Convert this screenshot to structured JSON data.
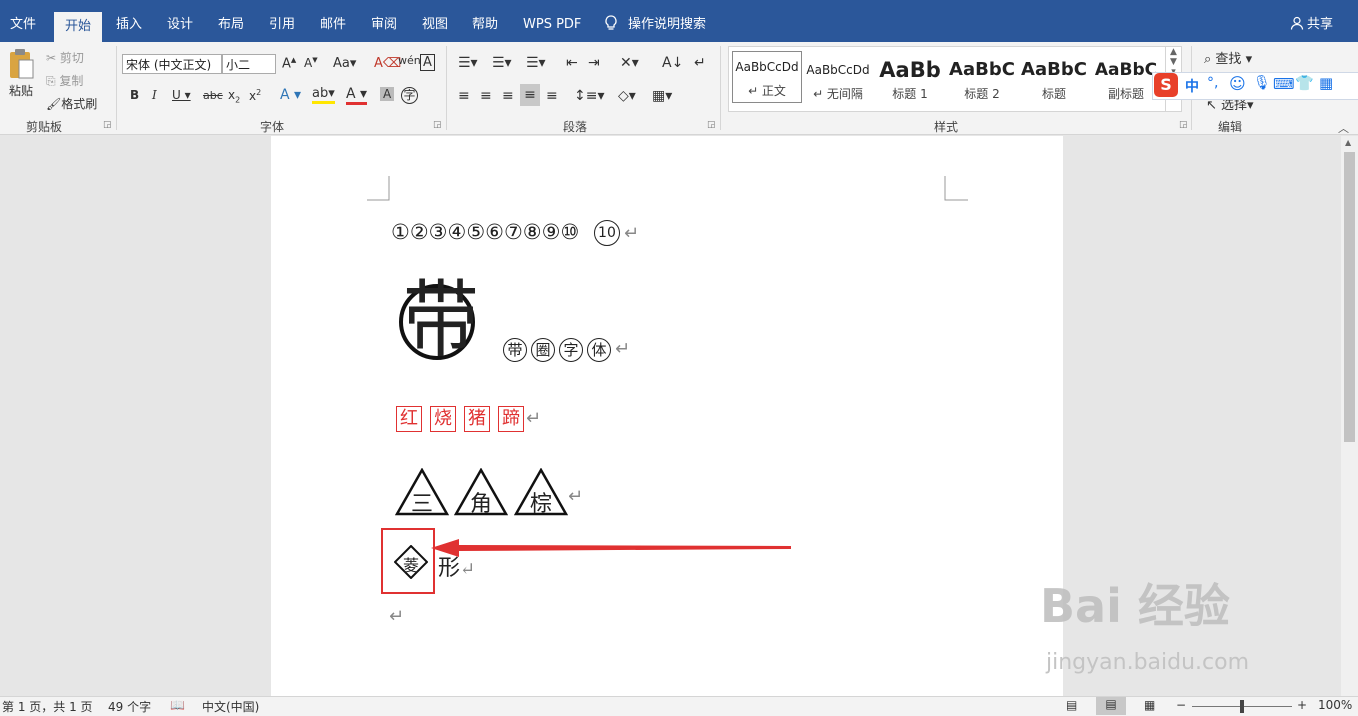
{
  "tabs": [
    {
      "label": "文件"
    },
    {
      "label": "开始"
    },
    {
      "label": "插入"
    },
    {
      "label": "设计"
    },
    {
      "label": "布局"
    },
    {
      "label": "引用"
    },
    {
      "label": "邮件"
    },
    {
      "label": "审阅"
    },
    {
      "label": "视图"
    },
    {
      "label": "帮助"
    },
    {
      "label": "WPS PDF"
    }
  ],
  "tell_me": "操作说明搜索",
  "share": "共享",
  "clipboard": {
    "paste": "粘贴",
    "cut": "剪切",
    "copy": "复制",
    "format_painter": "格式刷",
    "group": "剪贴板"
  },
  "font": {
    "family": "宋体 (中文正文)",
    "size": "小二",
    "group": "字体"
  },
  "paragraph": {
    "group": "段落"
  },
  "styles": {
    "group": "样式",
    "items": [
      {
        "preview": "AaBbCcDd",
        "name": "↵ 正文"
      },
      {
        "preview": "AaBbCcDd",
        "name": "↵ 无间隔"
      },
      {
        "preview": "AaBb",
        "name": "标题 1"
      },
      {
        "preview": "AaBbC",
        "name": "标题 2"
      },
      {
        "preview": "AaBbC",
        "name": "标题"
      },
      {
        "preview": "AaBbC",
        "name": "副标题"
      }
    ]
  },
  "editing": {
    "find": "查找",
    "select": "选择",
    "group": "编辑"
  },
  "ime": {
    "mode": "中"
  },
  "document": {
    "line1_numbers": [
      "①",
      "②",
      "③",
      "④",
      "⑤",
      "⑥",
      "⑦",
      "⑧",
      "⑨",
      "⑩"
    ],
    "line1_extra": "10",
    "big_char": "带",
    "line2_chars": [
      "带",
      "圈",
      "字",
      "体"
    ],
    "line3_chars": [
      "红",
      "烧",
      "猪",
      "蹄"
    ],
    "line4_chars": [
      "三",
      "角",
      "棕"
    ],
    "line5_diamond": "菱",
    "line5_rest": "形",
    "return_mark": "↵"
  },
  "status": {
    "page": "第 1 页，共 1 页",
    "words": "49 个字",
    "lang": "中文(中国)",
    "zoom": "100%"
  },
  "watermark": {
    "brand": "Bai 经验",
    "url": "jingyan.baidu.com"
  },
  "colors": {
    "brand_blue": "#2b579a",
    "accent_red": "#e03131"
  }
}
